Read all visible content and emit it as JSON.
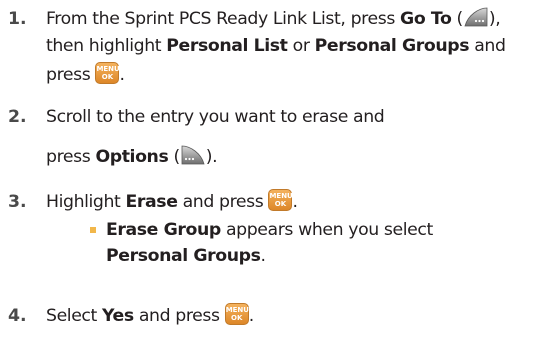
{
  "steps": [
    {
      "number": "1.",
      "lines": [
        [
          "From the Sprint PCS Ready Link List, press ",
          "Go To",
          " (",
          "), "
        ],
        [
          "then highlight ",
          "Personal List",
          " or ",
          "Personal Groups",
          " and"
        ],
        [
          "press ",
          "."
        ]
      ]
    },
    {
      "number": "2.",
      "lines": [
        [
          "Scroll to the entry you want to erase and"
        ],
        [
          "press ",
          "Options",
          " (",
          ")."
        ]
      ]
    },
    {
      "number": "3.",
      "lines": [
        [
          "Highlight ",
          "Erase",
          " and press ",
          "."
        ]
      ],
      "sub": {
        "lines": [
          [
            "Erase Group",
            " appears when you select"
          ],
          [
            "Personal Groups",
            "."
          ]
        ]
      }
    },
    {
      "number": "4.",
      "lines": [
        [
          "Select ",
          "Yes",
          " and press ",
          "."
        ]
      ]
    }
  ],
  "icons": {
    "menu_key_top": "MENU",
    "menu_key_bottom": "OK",
    "left_softkey": "left-softkey-icon",
    "right_softkey": "right-softkey-icon"
  },
  "colors": {
    "text": "#231f20",
    "number": "#4a4a4a",
    "bullet": "#f2b74a",
    "menu_key": "#e8962f"
  }
}
